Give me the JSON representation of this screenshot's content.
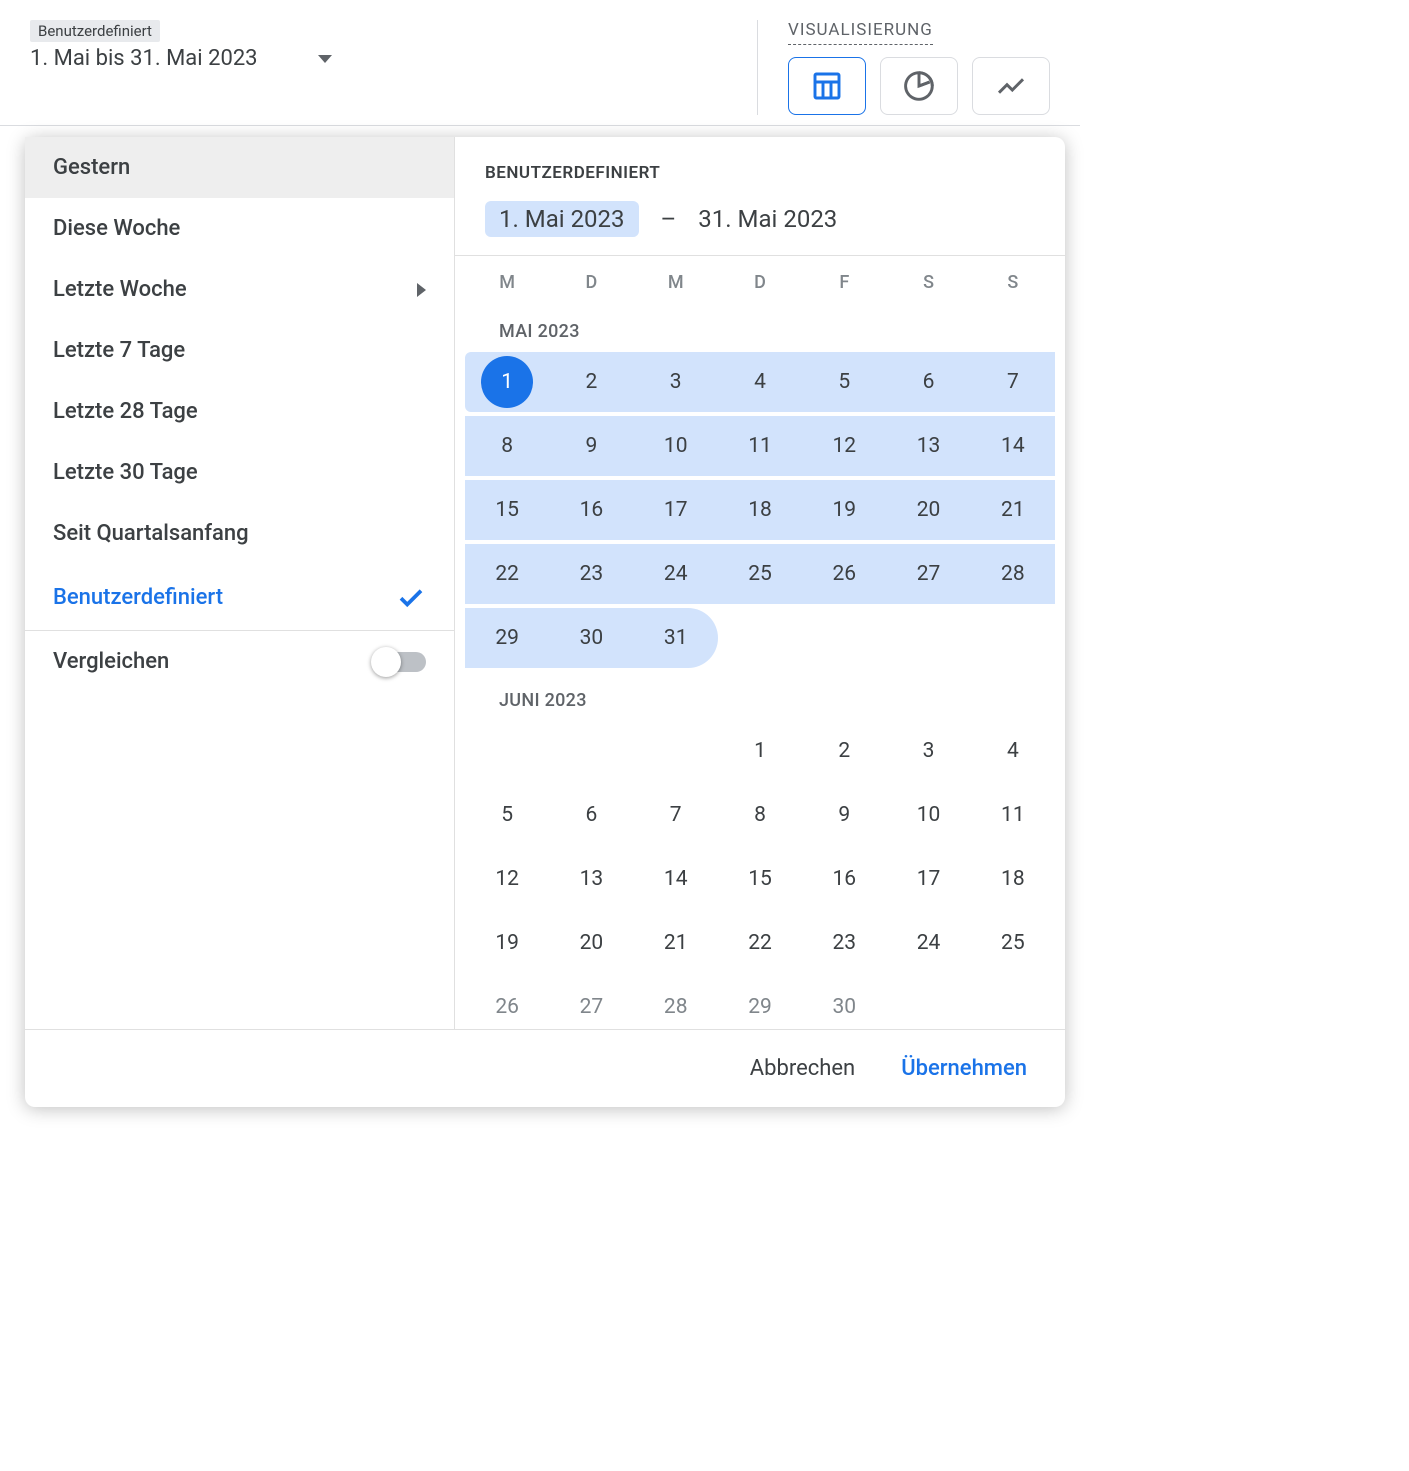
{
  "dateTrigger": {
    "badge": "Benutzerdefiniert",
    "rangeText": "1. Mai bis 31. Mai 2023"
  },
  "visualization": {
    "label": "VISUALISIERUNG"
  },
  "presets": [
    {
      "label": "Gestern",
      "state": "hover"
    },
    {
      "label": "Diese Woche",
      "state": ""
    },
    {
      "label": "Letzte Woche",
      "state": "submenu"
    },
    {
      "label": "Letzte 7 Tage",
      "state": ""
    },
    {
      "label": "Letzte 28 Tage",
      "state": ""
    },
    {
      "label": "Letzte 30 Tage",
      "state": ""
    },
    {
      "label": "Seit Quartalsanfang",
      "state": ""
    },
    {
      "label": "Benutzerdefiniert",
      "state": "selected"
    }
  ],
  "compare": {
    "label": "Vergleichen",
    "on": false
  },
  "calHeader": {
    "title": "BENUTZERDEFINIERT",
    "start": "1. Mai 2023",
    "sep": "–",
    "end": "31. Mai 2023"
  },
  "dow": [
    "M",
    "D",
    "M",
    "D",
    "F",
    "S",
    "S"
  ],
  "months": [
    {
      "label": "MAI 2023",
      "weeks": [
        [
          {
            "d": 1,
            "s": "start"
          },
          {
            "d": 2,
            "s": "in"
          },
          {
            "d": 3,
            "s": "in"
          },
          {
            "d": 4,
            "s": "in"
          },
          {
            "d": 5,
            "s": "in"
          },
          {
            "d": 6,
            "s": "in"
          },
          {
            "d": 7,
            "s": "in"
          }
        ],
        [
          {
            "d": 8,
            "s": "in"
          },
          {
            "d": 9,
            "s": "in"
          },
          {
            "d": 10,
            "s": "in"
          },
          {
            "d": 11,
            "s": "in"
          },
          {
            "d": 12,
            "s": "in"
          },
          {
            "d": 13,
            "s": "in"
          },
          {
            "d": 14,
            "s": "in"
          }
        ],
        [
          {
            "d": 15,
            "s": "in"
          },
          {
            "d": 16,
            "s": "in"
          },
          {
            "d": 17,
            "s": "in"
          },
          {
            "d": 18,
            "s": "in"
          },
          {
            "d": 19,
            "s": "in"
          },
          {
            "d": 20,
            "s": "in"
          },
          {
            "d": 21,
            "s": "in"
          }
        ],
        [
          {
            "d": 22,
            "s": "in"
          },
          {
            "d": 23,
            "s": "in"
          },
          {
            "d": 24,
            "s": "in"
          },
          {
            "d": 25,
            "s": "in"
          },
          {
            "d": 26,
            "s": "in"
          },
          {
            "d": 27,
            "s": "in"
          },
          {
            "d": 28,
            "s": "in"
          }
        ],
        [
          {
            "d": 29,
            "s": "in"
          },
          {
            "d": 30,
            "s": "in"
          },
          {
            "d": 31,
            "s": "end"
          },
          null,
          null,
          null,
          null
        ]
      ]
    },
    {
      "label": "JUNI 2023",
      "weeks": [
        [
          null,
          null,
          null,
          {
            "d": 1
          },
          {
            "d": 2
          },
          {
            "d": 3
          },
          {
            "d": 4
          }
        ],
        [
          {
            "d": 5
          },
          {
            "d": 6
          },
          {
            "d": 7
          },
          {
            "d": 8
          },
          {
            "d": 9
          },
          {
            "d": 10
          },
          {
            "d": 11
          }
        ],
        [
          {
            "d": 12
          },
          {
            "d": 13
          },
          {
            "d": 14
          },
          {
            "d": 15
          },
          {
            "d": 16
          },
          {
            "d": 17
          },
          {
            "d": 18
          }
        ],
        [
          {
            "d": 19
          },
          {
            "d": 20
          },
          {
            "d": 21
          },
          {
            "d": 22
          },
          {
            "d": 23
          },
          {
            "d": 24
          },
          {
            "d": 25
          }
        ],
        [
          {
            "d": 26,
            "s": "clip"
          },
          {
            "d": 27,
            "s": "clip"
          },
          {
            "d": 28,
            "s": "clip"
          },
          {
            "d": 29,
            "s": "clip"
          },
          {
            "d": 30,
            "s": "clip"
          },
          null,
          null
        ]
      ]
    }
  ],
  "footer": {
    "cancel": "Abbrechen",
    "apply": "Übernehmen"
  }
}
